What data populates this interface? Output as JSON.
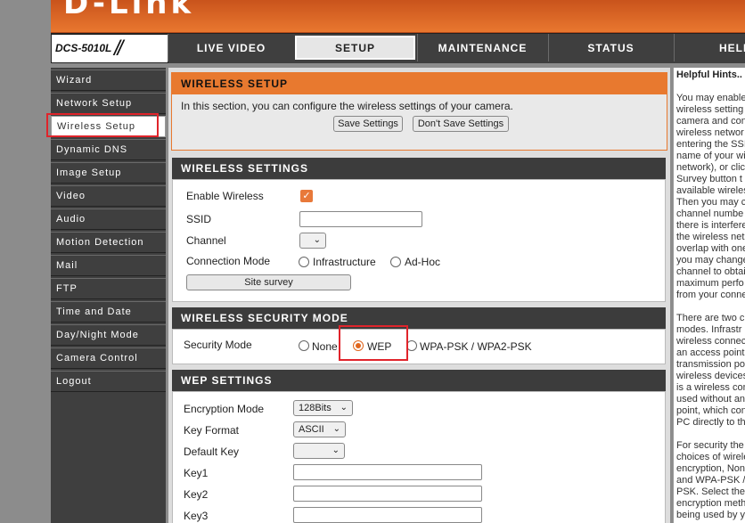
{
  "brand": "D-Link",
  "model": "DCS-5010L",
  "nav_tabs": [
    "LIVE VIDEO",
    "SETUP",
    "MAINTENANCE",
    "STATUS",
    "HELP"
  ],
  "sidebar": {
    "items": [
      "Wizard",
      "Network Setup",
      "Wireless Setup",
      "Dynamic DNS",
      "Image Setup",
      "Video",
      "Audio",
      "Motion Detection",
      "Mail",
      "FTP",
      "Time and Date",
      "Day/Night Mode",
      "Camera Control",
      "Logout"
    ],
    "active": "Wireless Setup"
  },
  "wireless_setup": {
    "title": "WIRELESS SETUP",
    "description": "In this section, you can configure the wireless settings of your camera.",
    "save_label": "Save Settings",
    "dont_save_label": "Don't Save Settings"
  },
  "wireless_settings": {
    "title": "WIRELESS SETTINGS",
    "enable_label": "Enable Wireless",
    "enable_checked": true,
    "ssid_label": "SSID",
    "ssid_value": "",
    "channel_label": "Channel",
    "channel_value": "",
    "mode_label": "Connection Mode",
    "mode_options": [
      "Infrastructure",
      "Ad-Hoc"
    ],
    "site_survey_label": "Site survey"
  },
  "security_mode": {
    "title": "WIRELESS SECURITY MODE",
    "label": "Security Mode",
    "options": [
      "None",
      "WEP",
      "WPA-PSK / WPA2-PSK"
    ],
    "selected": "WEP"
  },
  "wep_settings": {
    "title": "WEP SETTINGS",
    "encryption_label": "Encryption Mode",
    "encryption_value": "128Bits",
    "key_format_label": "Key Format",
    "key_format_value": "ASCII",
    "default_key_label": "Default Key",
    "default_key_value": "",
    "key1_label": "Key1",
    "key2_label": "Key2",
    "key3_label": "Key3"
  },
  "hints": {
    "title": "Helpful Hints..",
    "lines": [
      "You may enable",
      "wireless setting",
      "camera and con",
      "wireless networ",
      "entering the SSI",
      "name of your wi",
      "network), or clic",
      "Survey button t",
      "available wireles",
      "Then you may c",
      "channel numbe",
      "there is interfere",
      "the wireless net",
      "overlap with one",
      "you may change",
      "channel to obtai",
      "maximum perfo",
      "from your conne",
      "",
      "There are two c",
      "modes. Infrastr",
      "wireless connec",
      "an access point",
      "transmission po",
      "wireless devices",
      "is a wireless con",
      "used without an",
      "point, which con",
      "PC directly to th",
      "",
      "For security the",
      "choices of wirele",
      "encryption, Non",
      "and WPA-PSK /",
      "PSK. Select the",
      "encryption meth",
      "being used by y"
    ]
  },
  "colors": {
    "orange": "#e8792f",
    "dark": "#3c3c3c",
    "highlight": "#e0242b"
  }
}
